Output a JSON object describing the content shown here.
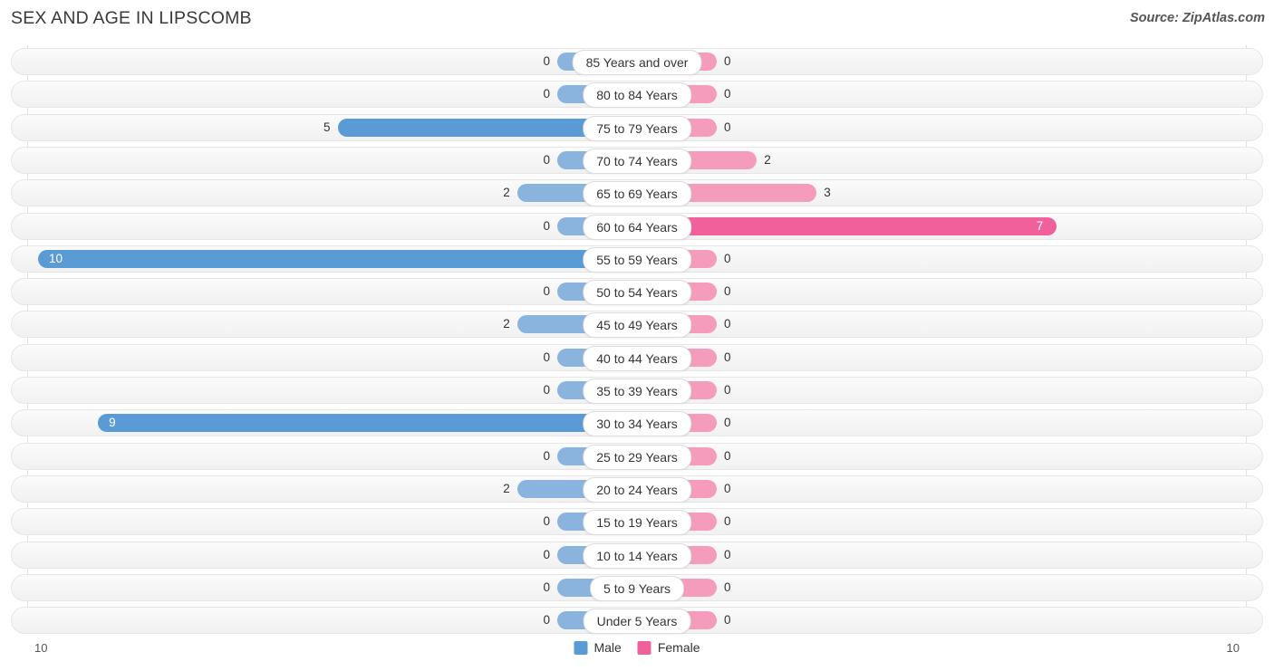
{
  "header": {
    "title": "SEX AND AGE IN LIPSCOMB",
    "source": "Source: ZipAtlas.com"
  },
  "legend": {
    "male_label": "Male",
    "female_label": "Female",
    "male_color": "#5b9bd5",
    "female_color": "#f0609a"
  },
  "axis": {
    "left_end": "10",
    "right_end": "10",
    "max": 10
  },
  "chart_data": {
    "type": "bar",
    "title": "SEX AND AGE IN LIPSCOMB",
    "subtitle": "Source: ZipAtlas.com",
    "orientation": "horizontal",
    "layout": "population-pyramid",
    "xlabel": "",
    "ylabel": "",
    "xlim": [
      10,
      10
    ],
    "grid": true,
    "legend_position": "bottom-center",
    "categories": [
      "85 Years and over",
      "80 to 84 Years",
      "75 to 79 Years",
      "70 to 74 Years",
      "65 to 69 Years",
      "60 to 64 Years",
      "55 to 59 Years",
      "50 to 54 Years",
      "45 to 49 Years",
      "40 to 44 Years",
      "35 to 39 Years",
      "30 to 34 Years",
      "25 to 29 Years",
      "20 to 24 Years",
      "15 to 19 Years",
      "10 to 14 Years",
      "5 to 9 Years",
      "Under 5 Years"
    ],
    "series": [
      {
        "name": "Male",
        "color": "#5b9bd5",
        "values": [
          0,
          0,
          5,
          0,
          2,
          0,
          10,
          0,
          2,
          0,
          0,
          9,
          0,
          2,
          0,
          0,
          0,
          0
        ]
      },
      {
        "name": "Female",
        "color": "#f0609a",
        "values": [
          0,
          0,
          0,
          2,
          3,
          7,
          0,
          0,
          0,
          0,
          0,
          0,
          0,
          0,
          0,
          0,
          0,
          0
        ]
      }
    ]
  },
  "rows": [
    {
      "age": "85 Years and over",
      "male": 0,
      "male_text": "0",
      "female": 0,
      "female_text": "0"
    },
    {
      "age": "80 to 84 Years",
      "male": 0,
      "male_text": "0",
      "female": 0,
      "female_text": "0"
    },
    {
      "age": "75 to 79 Years",
      "male": 5,
      "male_text": "5",
      "female": 0,
      "female_text": "0"
    },
    {
      "age": "70 to 74 Years",
      "male": 0,
      "male_text": "0",
      "female": 2,
      "female_text": "2"
    },
    {
      "age": "65 to 69 Years",
      "male": 2,
      "male_text": "2",
      "female": 3,
      "female_text": "3"
    },
    {
      "age": "60 to 64 Years",
      "male": 0,
      "male_text": "0",
      "female": 7,
      "female_text": "7"
    },
    {
      "age": "55 to 59 Years",
      "male": 10,
      "male_text": "10",
      "female": 0,
      "female_text": "0"
    },
    {
      "age": "50 to 54 Years",
      "male": 0,
      "male_text": "0",
      "female": 0,
      "female_text": "0"
    },
    {
      "age": "45 to 49 Years",
      "male": 2,
      "male_text": "2",
      "female": 0,
      "female_text": "0"
    },
    {
      "age": "40 to 44 Years",
      "male": 0,
      "male_text": "0",
      "female": 0,
      "female_text": "0"
    },
    {
      "age": "35 to 39 Years",
      "male": 0,
      "male_text": "0",
      "female": 0,
      "female_text": "0"
    },
    {
      "age": "30 to 34 Years",
      "male": 9,
      "male_text": "9",
      "female": 0,
      "female_text": "0"
    },
    {
      "age": "25 to 29 Years",
      "male": 0,
      "male_text": "0",
      "female": 0,
      "female_text": "0"
    },
    {
      "age": "20 to 24 Years",
      "male": 2,
      "male_text": "2",
      "female": 0,
      "female_text": "0"
    },
    {
      "age": "15 to 19 Years",
      "male": 0,
      "male_text": "0",
      "female": 0,
      "female_text": "0"
    },
    {
      "age": "10 to 14 Years",
      "male": 0,
      "male_text": "0",
      "female": 0,
      "female_text": "0"
    },
    {
      "age": "5 to 9 Years",
      "male": 0,
      "male_text": "0",
      "female": 0,
      "female_text": "0"
    },
    {
      "age": "Under 5 Years",
      "male": 0,
      "male_text": "0",
      "female": 0,
      "female_text": "0"
    }
  ]
}
